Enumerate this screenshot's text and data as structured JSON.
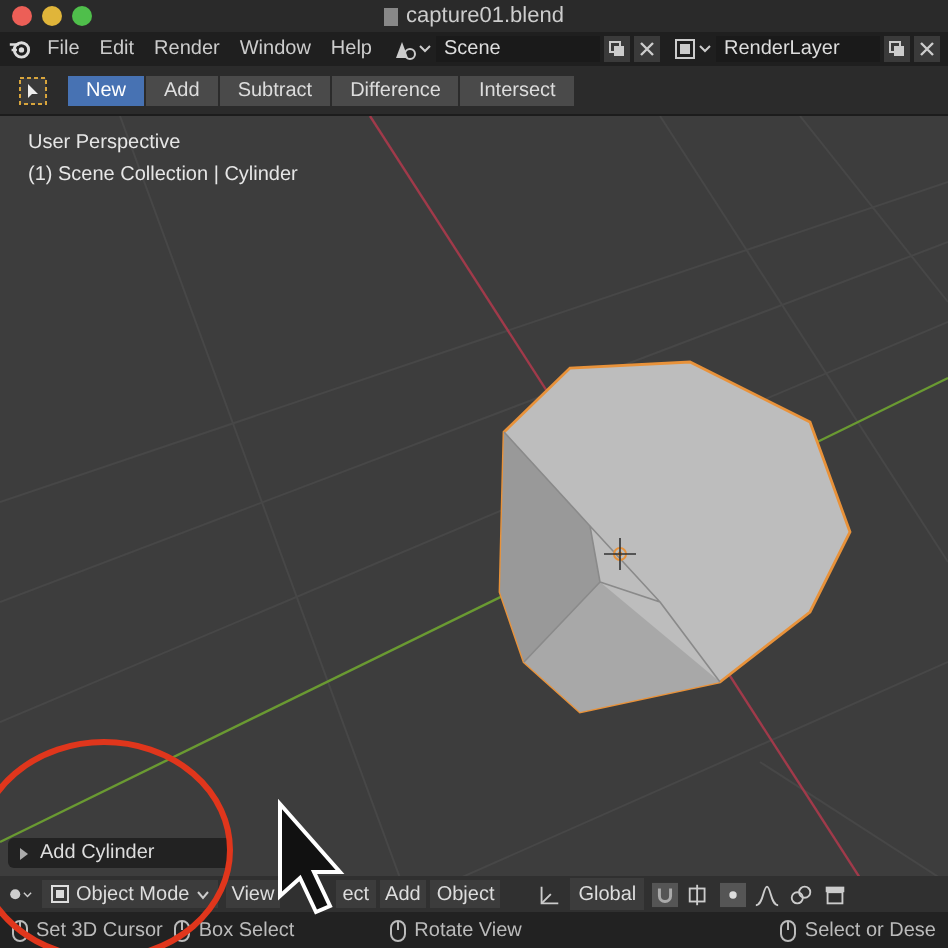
{
  "window": {
    "title": "capture01.blend"
  },
  "menu": [
    "File",
    "Edit",
    "Render",
    "Window",
    "Help"
  ],
  "scene": {
    "value": "Scene"
  },
  "view_layer": {
    "value": "RenderLayer"
  },
  "tool_header": {
    "modes": [
      {
        "label": "New",
        "selected": true
      },
      {
        "label": "Add",
        "selected": false
      },
      {
        "label": "Subtract",
        "selected": false
      },
      {
        "label": "Difference",
        "selected": false
      },
      {
        "label": "Intersect",
        "selected": false
      }
    ]
  },
  "viewport": {
    "overlay_lines": [
      "User Perspective",
      "(1) Scene Collection | Cylinder"
    ],
    "last_operator": {
      "label": "Add Cylinder",
      "expanded": false
    }
  },
  "viewport_header": {
    "mode": "Object Mode",
    "menus": [
      "View",
      "ect",
      "Add",
      "Object"
    ],
    "orientation": "Global"
  },
  "status_bar": [
    {
      "label": "Set 3D Cursor"
    },
    {
      "label": "Box Select"
    },
    {
      "label": "Rotate View"
    },
    {
      "label": "Select or Dese"
    }
  ]
}
